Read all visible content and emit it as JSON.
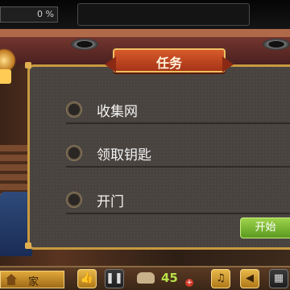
{
  "hud": {
    "progress_text": "0 %",
    "progress": 0
  },
  "quest_panel": {
    "title": "任务",
    "tasks": [
      {
        "label": "收集网",
        "done": false
      },
      {
        "label": "领取钥匙",
        "done": false
      },
      {
        "label": "开门",
        "done": false
      }
    ],
    "start_button": "开始"
  },
  "bottom_bar": {
    "home_label": "家",
    "coin_count": "45",
    "buttons": [
      {
        "icon": "thumbs-up-icon"
      },
      {
        "icon": "pause-icon"
      },
      {
        "icon": "hint-hand-icon"
      },
      {
        "icon": "coin-add-icon"
      },
      {
        "icon": "map-icon"
      },
      {
        "icon": "music-icon"
      },
      {
        "icon": "sound-icon"
      },
      {
        "icon": "inventory-icon"
      }
    ]
  },
  "colors": {
    "panel_border": "#c89a40",
    "banner": "#c84a22",
    "start_button": "#7ab83a",
    "coin_text": "#b8e04a"
  }
}
